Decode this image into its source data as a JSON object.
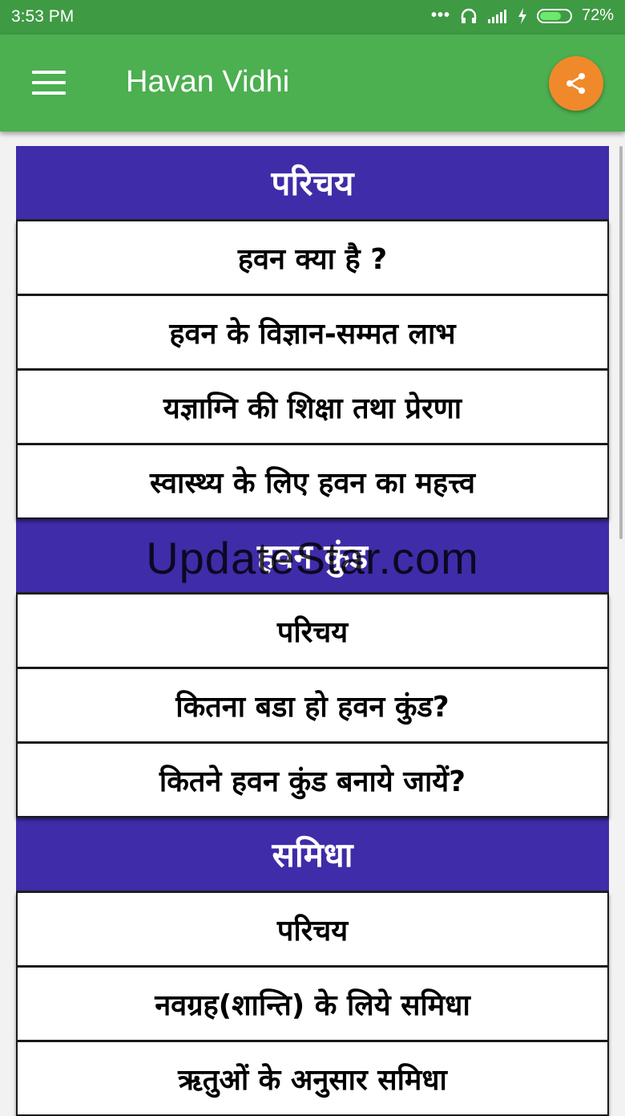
{
  "status_bar": {
    "time": "3:53 PM",
    "battery_percent": "72%",
    "battery_level": 0.72
  },
  "app_bar": {
    "title": "Havan Vidhi",
    "menu_icon": "hamburger-menu-icon",
    "share_icon": "share-icon",
    "share_color": "#f0892a"
  },
  "colors": {
    "app_bar": "#4caf50",
    "status_bar": "#3f9a44",
    "section_header": "#3f2ca8"
  },
  "sections": [
    {
      "title": "परिचय",
      "items": [
        "हवन क्या है ?",
        "हवन के विज्ञान-सम्मत लाभ",
        "यज्ञाग्नि की शिक्षा तथा प्रेरणा",
        "स्वास्थ्य के लिए हवन का महत्त्व"
      ]
    },
    {
      "title": "हवन कुंड",
      "items": [
        "परिचय",
        "कितना बडा हो हवन कुंड?",
        "कितने हवन कुंड बनाये जायें?"
      ]
    },
    {
      "title": "समिधा",
      "items": [
        "परिचय",
        "नवग्रह(शान्ति) के लिये समिधा",
        "ऋतुओं के अनुसार समिधा"
      ]
    }
  ],
  "watermark": "UpdateStar.com"
}
